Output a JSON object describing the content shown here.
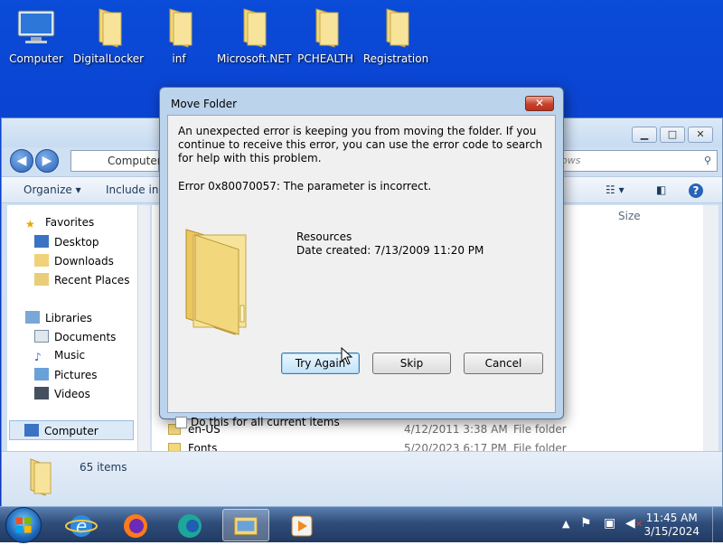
{
  "desktop": {
    "icons": [
      {
        "label": "Computer",
        "icon": "computer-icon"
      },
      {
        "label": "DigitalLocker",
        "icon": "folder-icon"
      },
      {
        "label": "inf",
        "icon": "folder-icon"
      },
      {
        "label": "Microsoft.NET",
        "icon": "folder-icon"
      },
      {
        "label": "PCHEALTH",
        "icon": "folder-icon"
      },
      {
        "label": "Registration",
        "icon": "folder-icon"
      }
    ]
  },
  "explorer": {
    "address": "Computer",
    "search_placeholder": "ows",
    "toolbar": {
      "organize": "Organize ▾",
      "include": "Include in l"
    },
    "column_size": "Size",
    "nav": {
      "favorites": "Favorites",
      "desktop": "Desktop",
      "downloads": "Downloads",
      "recent": "Recent Places",
      "libraries": "Libraries",
      "documents": "Documents",
      "music": "Music",
      "pictures": "Pictures",
      "videos": "Videos",
      "computer": "Computer"
    },
    "rows": [
      {
        "name": "en-US",
        "date": "4/12/2011 3:38 AM",
        "type": "File folder"
      },
      {
        "name": "Fonts",
        "date": "5/20/2023 6:17 PM",
        "type": "File folder"
      }
    ],
    "status": "65 items"
  },
  "dialog": {
    "title": "Move Folder",
    "message": "An unexpected error is keeping you from moving the folder. If you continue to receive this error, you can use the error code to search for help with this problem.",
    "error": "Error 0x80070057: The parameter is incorrect.",
    "item_name": "Resources",
    "item_date": "Date created: 7/13/2009 11:20 PM",
    "try_again": "Try Again",
    "skip": "Skip",
    "cancel": "Cancel",
    "checkbox_label": "Do this for all current items"
  },
  "taskbar": {
    "time": "11:45 AM",
    "date": "3/15/2024"
  },
  "colors": {
    "accent": "#0b3fcc",
    "close_red": "#c9412b"
  }
}
